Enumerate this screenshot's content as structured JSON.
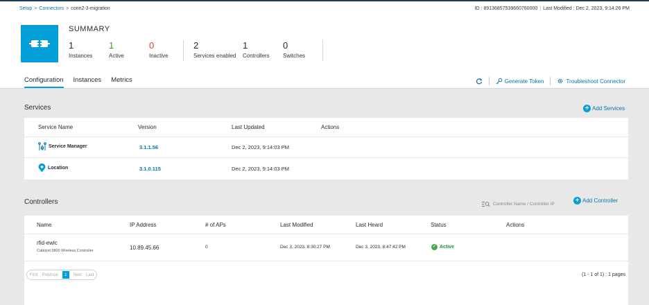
{
  "breadcrumb": {
    "items": [
      "Setup",
      "Connectors",
      "conn2-3-migration"
    ],
    "separator": ">"
  },
  "meta": {
    "id_text": "ID : 89136857539660760000",
    "last_modified": "Last Modified : Dec 2, 2023, 9:14:26 PM"
  },
  "summary": {
    "title": "SUMMARY",
    "stats": [
      {
        "value": "1",
        "label": "Instances"
      },
      {
        "value": "1",
        "label": "Active"
      },
      {
        "value": "0",
        "label": "Inactive"
      },
      {
        "value": "2",
        "label": "Services enabled"
      },
      {
        "value": "1",
        "label": "Controllers"
      },
      {
        "value": "0",
        "label": "Switches"
      }
    ]
  },
  "tabs": [
    "Configuration",
    "Instances",
    "Metrics"
  ],
  "actions": {
    "generate_token": "Generate Token",
    "troubleshoot": "Troubleshoot Connector"
  },
  "services": {
    "title": "Services",
    "add_label": "Add Services",
    "columns": [
      "Service Name",
      "Version",
      "Last Updated",
      "Actions"
    ],
    "rows": [
      {
        "name": "Service Manager",
        "icon": "service-manager-icon",
        "version": "3.1.1.56",
        "updated": "Dec 2, 2023, 9:14:03 PM"
      },
      {
        "name": "Location",
        "icon": "location-pin-icon",
        "version": "3.1.0.115",
        "updated": "Dec 2, 2023, 9:14:03 PM"
      }
    ]
  },
  "controllers": {
    "title": "Controllers",
    "add_label": "Add Controller",
    "search_placeholder": "Controller Name / Controller IP",
    "columns": [
      "Name",
      "IP Address",
      "# of APs",
      "Last Modified",
      "Last Heard",
      "Status",
      "Actions"
    ],
    "rows": [
      {
        "name": "rfid-ewlc",
        "model": "Catalyst 9800 Wireless Controller",
        "ip": "10.89.45.66",
        "aps": "0",
        "modified": "Dec 3, 2023, 8:30:27 PM",
        "heard": "Dec 3, 2023, 8:47:42 PM",
        "status": "Active"
      }
    ],
    "pager": {
      "first": "First",
      "previous": "Previous",
      "current": "1",
      "next": "Next",
      "last": "Last"
    },
    "page_info": "(1 - 1 of 1) : 1 pages"
  },
  "colors": {
    "accent": "#049fd9",
    "link": "#0a74a8",
    "active": "#3e9b1b",
    "inactive": "#d0442b"
  }
}
